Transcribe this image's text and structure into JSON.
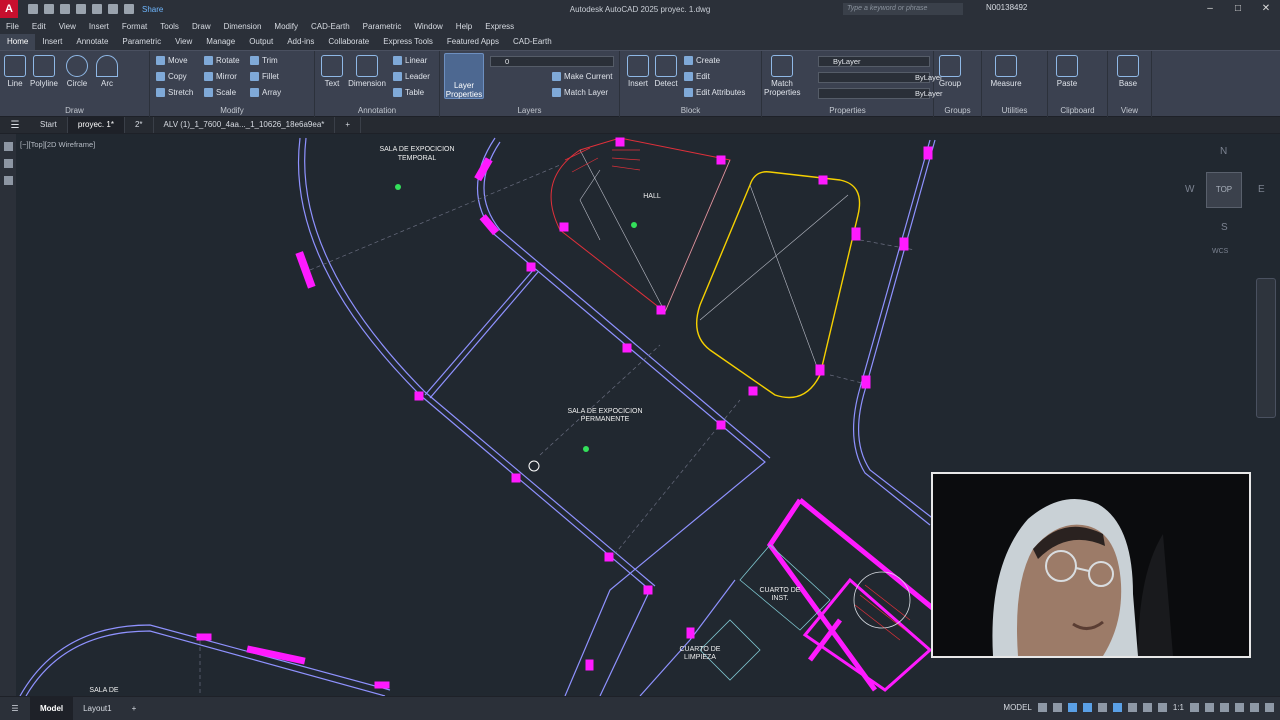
{
  "titlebar": {
    "logo": "A",
    "share": "Share",
    "title": "Autodesk AutoCAD 2025   proyec. 1.dwg",
    "search_placeholder": "Type a keyword or phrase",
    "user": "N00138492"
  },
  "menu": [
    "File",
    "Edit",
    "View",
    "Insert",
    "Format",
    "Tools",
    "Draw",
    "Dimension",
    "Modify",
    "CAD-Earth",
    "Parametric",
    "Window",
    "Help",
    "Express"
  ],
  "ribbon_tabs": [
    "Home",
    "Insert",
    "Annotate",
    "Parametric",
    "View",
    "Manage",
    "Output",
    "Add-ins",
    "Collaborate",
    "Express Tools",
    "Featured Apps",
    "CAD-Earth"
  ],
  "ribbon": {
    "draw": {
      "title": "Draw",
      "line": "Line",
      "polyline": "Polyline",
      "circle": "Circle",
      "arc": "Arc"
    },
    "modify": {
      "title": "Modify",
      "move": "Move",
      "rotate": "Rotate",
      "trim": "Trim",
      "copy": "Copy",
      "mirror": "Mirror",
      "fillet": "Fillet",
      "stretch": "Stretch",
      "scale": "Scale",
      "array": "Array"
    },
    "annotation": {
      "title": "Annotation",
      "text": "Text",
      "dimension": "Dimension",
      "linear": "Linear",
      "leader": "Leader",
      "table": "Table"
    },
    "layers": {
      "title": "Layers",
      "layer_properties": "Layer Properties",
      "current_layer": "0",
      "make_current": "Make Current",
      "match_layer": "Match Layer"
    },
    "block": {
      "title": "Block",
      "insert": "Insert",
      "detect": "Detect",
      "create": "Create",
      "edit": "Edit",
      "edit_attributes": "Edit Attributes"
    },
    "properties": {
      "title": "Properties",
      "match": "Match Properties",
      "color": "ByLayer",
      "linetype": "ByLayer",
      "lineweight": "ByLayer"
    },
    "groups": {
      "title": "Groups",
      "group": "Group"
    },
    "utilities": {
      "title": "Utilities",
      "measure": "Measure"
    },
    "clipboard": {
      "title": "Clipboard",
      "paste": "Paste"
    },
    "view": {
      "title": "View",
      "base": "Base"
    }
  },
  "doc_tabs": [
    "Start",
    "proyec. 1*",
    "2*",
    "ALV (1)_1_7600_4aa..._1_10626_18e6a9ea*"
  ],
  "viewport": {
    "label": "[−][Top][2D Wireframe]",
    "navcube": {
      "n": "N",
      "s": "S",
      "e": "E",
      "w": "W",
      "top": "TOP",
      "wcs": "WCS"
    },
    "rooms": {
      "sala_temporal_1": "SALA DE EXPOCICION",
      "sala_temporal_2": "TEMPORAL",
      "hall": "HALL",
      "sala_perm_1": "SALA DE EXPOCICION",
      "sala_perm_2": "PERMANENTE",
      "cuarto_inst_1": "CUARTO DE",
      "cuarto_inst_2": "INST.",
      "cuarto_limp_1": "CUARTO DE",
      "cuarto_limp_2": "LIMPIEZA",
      "sala_bottom": "SALA DE"
    }
  },
  "status": {
    "model_tab": "Model",
    "layout1": "Layout1",
    "model_label": "MODEL",
    "scale": "1:1"
  },
  "colors": {
    "magenta": "#ff1aff",
    "wall": "#8f92ff",
    "red": "#e0303a",
    "yellow": "#f5d000",
    "accent": "#4d6891"
  }
}
